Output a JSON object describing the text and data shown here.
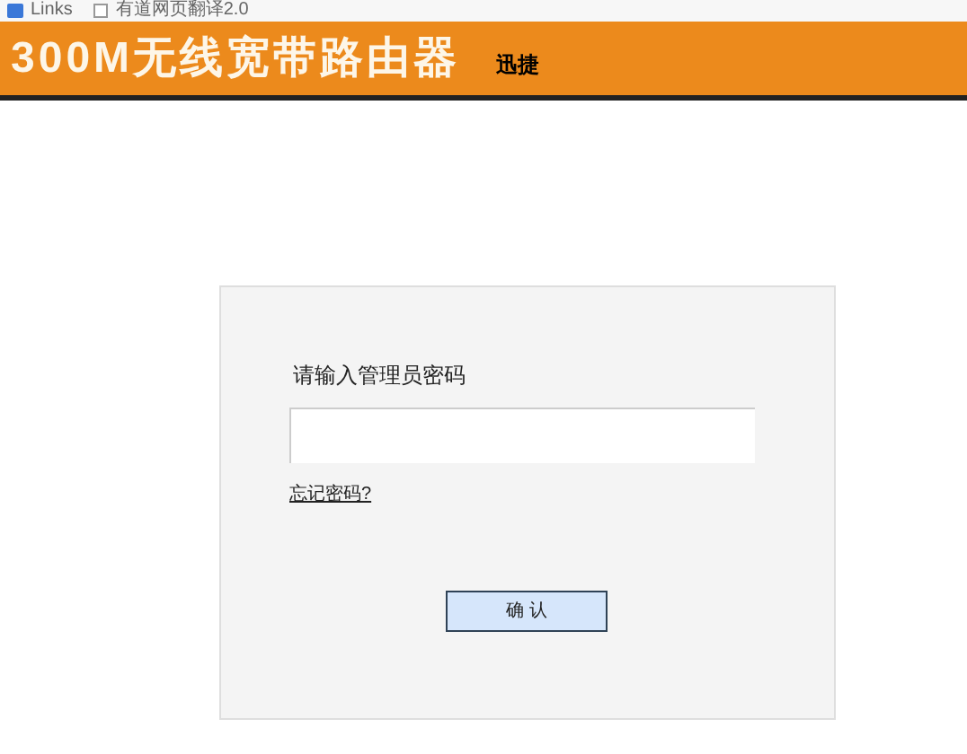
{
  "bookmarks": [
    {
      "label": "Links"
    },
    {
      "label": "有道网页翻译2.0"
    }
  ],
  "header": {
    "title": "300M无线宽带路由器",
    "brand": "迅捷"
  },
  "login": {
    "label": "请输入管理员密码",
    "forgot_link": "忘记密码?",
    "confirm_button": "确 认"
  }
}
